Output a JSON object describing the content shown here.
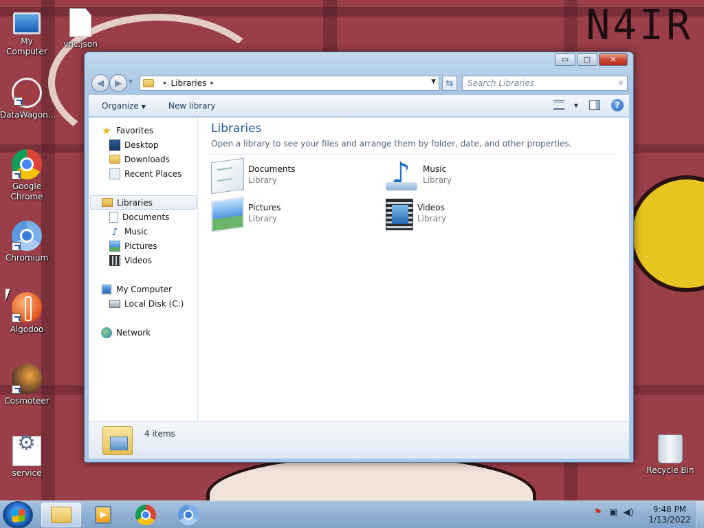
{
  "desktop": {
    "icons": [
      {
        "label": "My Computer"
      },
      {
        "label": "vnc.json"
      },
      {
        "label": "DataWagon..."
      },
      {
        "label": "Google Chrome"
      },
      {
        "label": "Chromium"
      },
      {
        "label": "Algodoo"
      },
      {
        "label": "Cosmoteer"
      },
      {
        "label": "service"
      },
      {
        "label": "Recycle Bin"
      }
    ],
    "wallpaper_text": "N4IR"
  },
  "window": {
    "controls": {
      "minimize": "▭",
      "maximize": "□",
      "close": "✕"
    },
    "address": {
      "segment": "Libraries",
      "sep1": "▸",
      "sep2": "▸"
    },
    "search": {
      "placeholder": "Search Libraries"
    },
    "toolbar": {
      "organize": "Organize",
      "new_library": "New library"
    },
    "navpane": {
      "favorites": "Favorites",
      "favorites_items": [
        "Desktop",
        "Downloads",
        "Recent Places"
      ],
      "libraries": "Libraries",
      "libraries_items": [
        "Documents",
        "Music",
        "Pictures",
        "Videos"
      ],
      "computer": "My Computer",
      "computer_items": [
        "Local Disk (C:)"
      ],
      "network": "Network"
    },
    "main": {
      "title": "Libraries",
      "subtitle": "Open a library to see your files and arrange them by folder, date, and other properties.",
      "libraries": [
        {
          "name": "Documents",
          "type": "Library",
          "icon": "documents-library-icon"
        },
        {
          "name": "Music",
          "type": "Library",
          "icon": "music-library-icon"
        },
        {
          "name": "Pictures",
          "type": "Library",
          "icon": "pictures-library-icon"
        },
        {
          "name": "Videos",
          "type": "Library",
          "icon": "videos-library-icon"
        }
      ]
    },
    "details": {
      "count": "4 items"
    }
  },
  "taskbar": {
    "clock_time": "9:48 PM",
    "clock_date": "1/13/2022"
  },
  "colors": {
    "title_accent": "#1e5a9c",
    "close_red": "#c7432d",
    "taskbar": "#8fb0d2"
  }
}
